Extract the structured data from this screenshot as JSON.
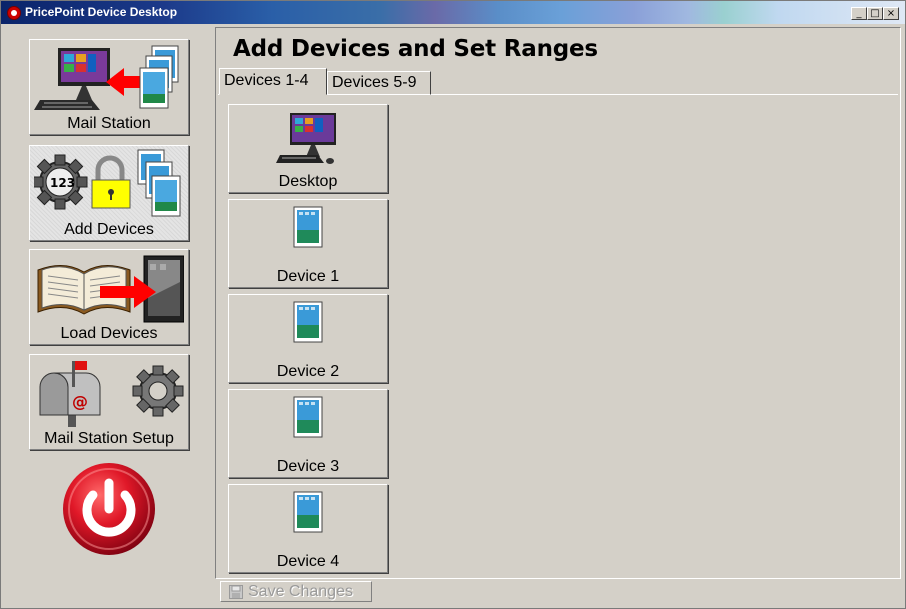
{
  "window": {
    "title": "PricePoint Device Desktop"
  },
  "window_controls": {
    "minimize": "_",
    "maximize": "□",
    "close": "×"
  },
  "sidebar": {
    "items": [
      {
        "label": "Mail Station",
        "icon": "desktop-transfer-icon"
      },
      {
        "label": "Add Devices",
        "icon": "gear-lock-devices-icon"
      },
      {
        "label": "Load Devices",
        "icon": "book-to-device-icon"
      },
      {
        "label": "Mail Station Setup",
        "icon": "mailbox-gear-icon"
      }
    ],
    "power_icon": "power-icon"
  },
  "main": {
    "title": "Add Devices and Set Ranges",
    "tabs": [
      {
        "label": "Devices 1-4",
        "active": true
      },
      {
        "label": "Devices 5-9",
        "active": false
      }
    ],
    "devices": [
      {
        "label": "Desktop",
        "icon": "desktop-computer-icon"
      },
      {
        "label": "Device 1",
        "icon": "tablet-icon"
      },
      {
        "label": "Device 2",
        "icon": "tablet-icon"
      },
      {
        "label": "Device 3",
        "icon": "tablet-icon"
      },
      {
        "label": "Device 4",
        "icon": "tablet-icon"
      }
    ]
  },
  "footer": {
    "save_label": "Save Changes",
    "save_icon": "floppy-disk-icon"
  },
  "colors": {
    "title_bar": "#0a246a",
    "face": "#d4d0c8",
    "power_red": "#d01020",
    "arrow_red": "#ff0000"
  }
}
